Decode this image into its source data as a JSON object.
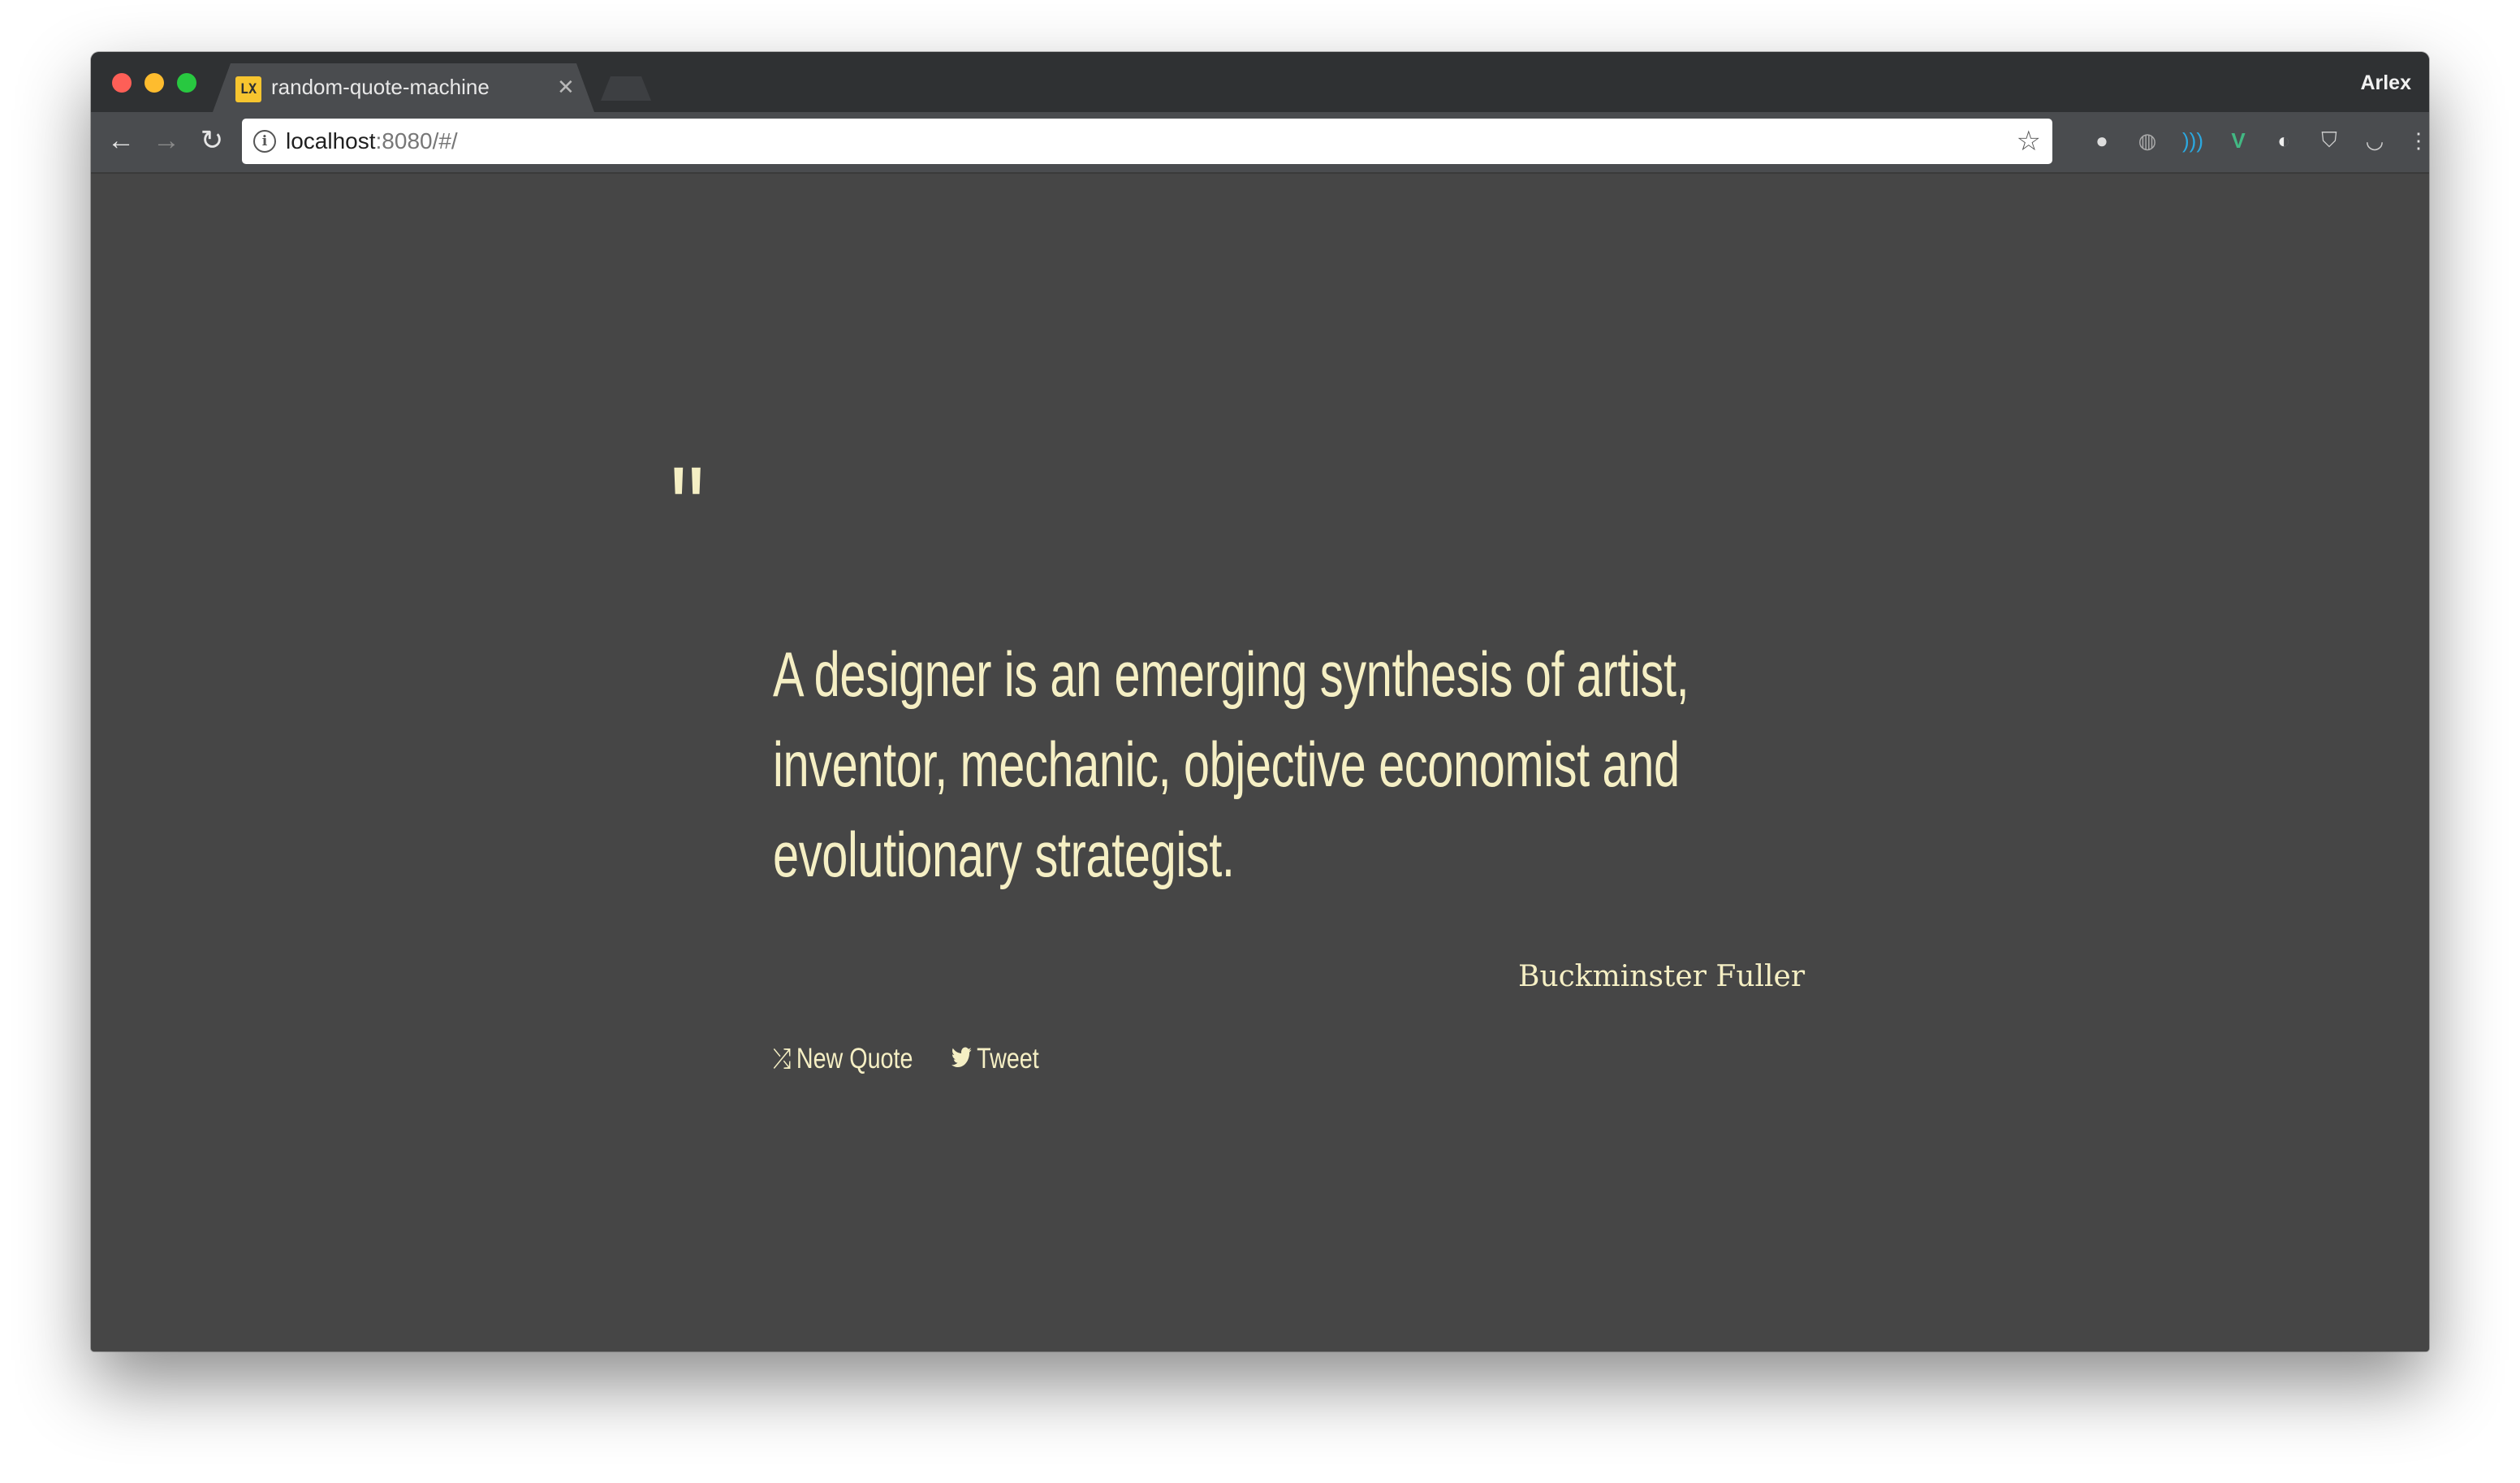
{
  "browser": {
    "tab_title": "random-quote-machine",
    "tab_favicon": "LX",
    "profile_name": "Arlex",
    "url_host": "localhost",
    "url_rest": ":8080/#/"
  },
  "quote": {
    "mark": "\"",
    "text": "A designer is an emerging synthesis of artist, inventor, mechanic, objective economist and evolutionary strategist.",
    "author": "Buckminster Fuller"
  },
  "actions": {
    "new_quote_label": "New Quote",
    "tweet_label": "Tweet"
  },
  "colors": {
    "background": "#464646",
    "accent_text": "#f5efc4"
  }
}
